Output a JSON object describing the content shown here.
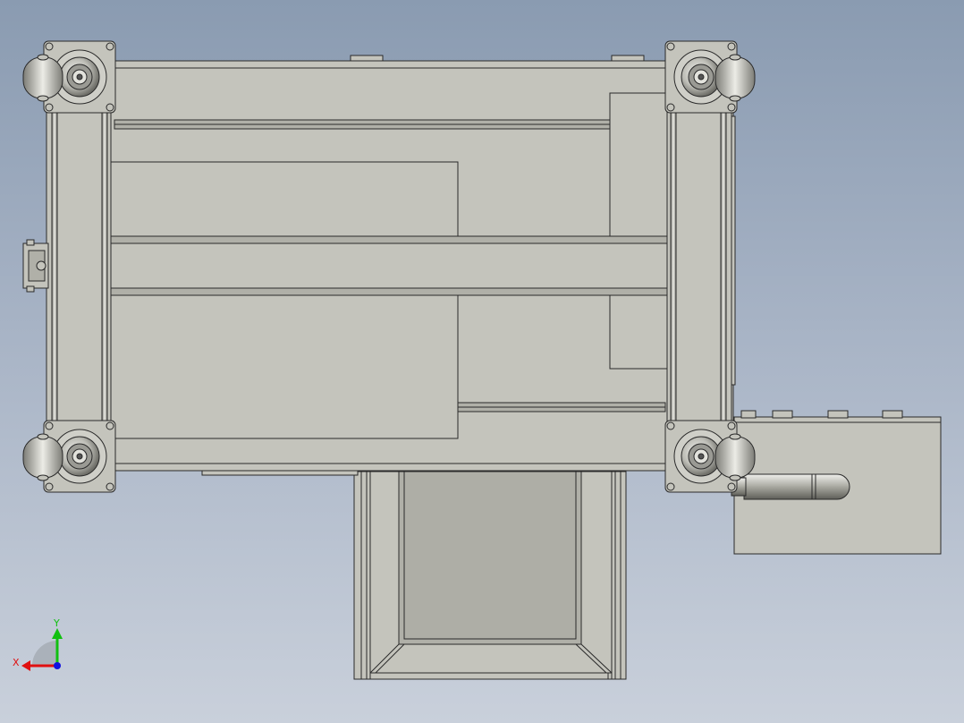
{
  "triad": {
    "x_label": "X",
    "y_label": "Y",
    "x_color": "#e01010",
    "y_color": "#10c010",
    "z_color": "#1010e0"
  },
  "colors": {
    "background_top": "#8a9bb1",
    "background_bottom": "#c9d0db",
    "part_fill": "#c4c4bc",
    "edge": "#2a2a2a"
  }
}
